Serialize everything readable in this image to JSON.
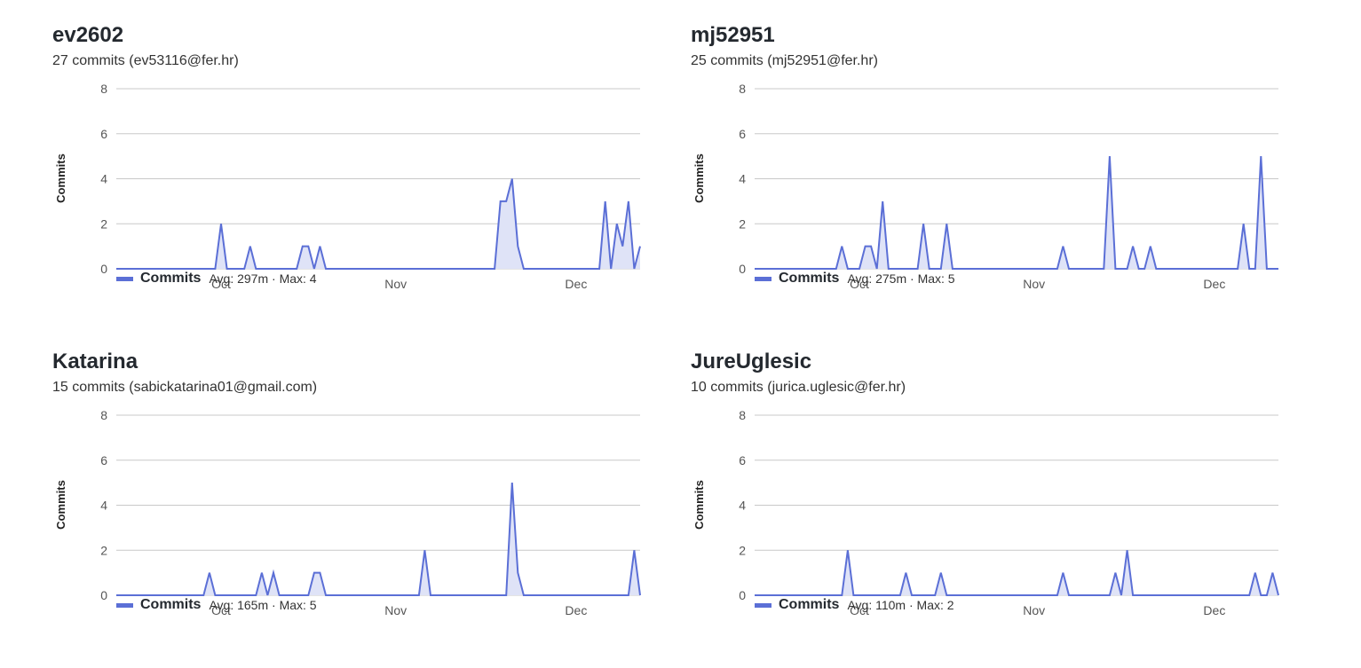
{
  "style": {
    "line_color": "#5b6fd6",
    "fill_color": "#dfe3f7",
    "grid_color": "#c8c8c8"
  },
  "panels": [
    {
      "name": "ev2602",
      "subtitle": "27 commits (ev53116@fer.hr)",
      "legend": {
        "label": "Commits",
        "stats": "Avg: 297m · Max: 4"
      }
    },
    {
      "name": "mj52951",
      "subtitle": "25 commits (mj52951@fer.hr)",
      "legend": {
        "label": "Commits",
        "stats": "Avg: 275m · Max: 5"
      }
    },
    {
      "name": "Katarina",
      "subtitle": "15 commits (sabickatarina01@gmail.com)",
      "legend": {
        "label": "Commits",
        "stats": "Avg: 165m · Max: 5"
      }
    },
    {
      "name": "JureUglesic",
      "subtitle": "10 commits (jurica.uglesic@fer.hr)",
      "legend": {
        "label": "Commits",
        "stats": "Avg: 110m · Max: 2"
      }
    }
  ],
  "chart_data": [
    {
      "type": "area",
      "ylabel": "Commits",
      "ylim": [
        0,
        8
      ],
      "yticks": [
        0,
        2,
        4,
        6,
        8
      ],
      "xlim": [
        0,
        90
      ],
      "xticks": [
        {
          "x": 18,
          "label": "Oct"
        },
        {
          "x": 48,
          "label": "Nov"
        },
        {
          "x": 79,
          "label": "Dec"
        }
      ],
      "grid": true,
      "legend_position": "bottom-left",
      "series": [
        {
          "name": "Commits",
          "points": [
            [
              0,
              0
            ],
            [
              17,
              0
            ],
            [
              18,
              2
            ],
            [
              19,
              0
            ],
            [
              22,
              0
            ],
            [
              23,
              1
            ],
            [
              24,
              0
            ],
            [
              31,
              0
            ],
            [
              32,
              1
            ],
            [
              33,
              1
            ],
            [
              34,
              0
            ],
            [
              35,
              1
            ],
            [
              36,
              0
            ],
            [
              65,
              0
            ],
            [
              66,
              3
            ],
            [
              67,
              3
            ],
            [
              68,
              4
            ],
            [
              69,
              1
            ],
            [
              70,
              0
            ],
            [
              83,
              0
            ],
            [
              84,
              3
            ],
            [
              85,
              0
            ],
            [
              86,
              2
            ],
            [
              87,
              1
            ],
            [
              88,
              3
            ],
            [
              89,
              0
            ],
            [
              90,
              1
            ]
          ]
        }
      ]
    },
    {
      "type": "area",
      "ylabel": "Commits",
      "ylim": [
        0,
        8
      ],
      "yticks": [
        0,
        2,
        4,
        6,
        8
      ],
      "xlim": [
        0,
        90
      ],
      "xticks": [
        {
          "x": 18,
          "label": "Oct"
        },
        {
          "x": 48,
          "label": "Nov"
        },
        {
          "x": 79,
          "label": "Dec"
        }
      ],
      "grid": true,
      "legend_position": "bottom-left",
      "series": [
        {
          "name": "Commits",
          "points": [
            [
              0,
              0
            ],
            [
              14,
              0
            ],
            [
              15,
              1
            ],
            [
              16,
              0
            ],
            [
              18,
              0
            ],
            [
              19,
              1
            ],
            [
              20,
              1
            ],
            [
              21,
              0
            ],
            [
              22,
              3
            ],
            [
              23,
              0
            ],
            [
              28,
              0
            ],
            [
              29,
              2
            ],
            [
              30,
              0
            ],
            [
              32,
              0
            ],
            [
              33,
              2
            ],
            [
              34,
              0
            ],
            [
              52,
              0
            ],
            [
              53,
              1
            ],
            [
              54,
              0
            ],
            [
              60,
              0
            ],
            [
              61,
              5
            ],
            [
              62,
              0
            ],
            [
              64,
              0
            ],
            [
              65,
              1
            ],
            [
              66,
              0
            ],
            [
              67,
              0
            ],
            [
              68,
              1
            ],
            [
              69,
              0
            ],
            [
              83,
              0
            ],
            [
              84,
              2
            ],
            [
              85,
              0
            ],
            [
              86,
              0
            ],
            [
              87,
              5
            ],
            [
              88,
              0
            ],
            [
              90,
              0
            ]
          ]
        }
      ]
    },
    {
      "type": "area",
      "ylabel": "Commits",
      "ylim": [
        0,
        8
      ],
      "yticks": [
        0,
        2,
        4,
        6,
        8
      ],
      "xlim": [
        0,
        90
      ],
      "xticks": [
        {
          "x": 18,
          "label": "Oct"
        },
        {
          "x": 48,
          "label": "Nov"
        },
        {
          "x": 79,
          "label": "Dec"
        }
      ],
      "grid": true,
      "legend_position": "bottom-left",
      "series": [
        {
          "name": "Commits",
          "points": [
            [
              0,
              0
            ],
            [
              15,
              0
            ],
            [
              16,
              1
            ],
            [
              17,
              0
            ],
            [
              24,
              0
            ],
            [
              25,
              1
            ],
            [
              26,
              0
            ],
            [
              27,
              1
            ],
            [
              28,
              0
            ],
            [
              33,
              0
            ],
            [
              34,
              1
            ],
            [
              35,
              1
            ],
            [
              36,
              0
            ],
            [
              52,
              0
            ],
            [
              53,
              2
            ],
            [
              54,
              0
            ],
            [
              67,
              0
            ],
            [
              68,
              5
            ],
            [
              69,
              1
            ],
            [
              70,
              0
            ],
            [
              88,
              0
            ],
            [
              89,
              2
            ],
            [
              90,
              0
            ]
          ]
        }
      ]
    },
    {
      "type": "area",
      "ylabel": "Commits",
      "ylim": [
        0,
        8
      ],
      "yticks": [
        0,
        2,
        4,
        6,
        8
      ],
      "xlim": [
        0,
        90
      ],
      "xticks": [
        {
          "x": 18,
          "label": "Oct"
        },
        {
          "x": 48,
          "label": "Nov"
        },
        {
          "x": 79,
          "label": "Dec"
        }
      ],
      "grid": true,
      "legend_position": "bottom-left",
      "series": [
        {
          "name": "Commits",
          "points": [
            [
              0,
              0
            ],
            [
              15,
              0
            ],
            [
              16,
              2
            ],
            [
              17,
              0
            ],
            [
              25,
              0
            ],
            [
              26,
              1
            ],
            [
              27,
              0
            ],
            [
              31,
              0
            ],
            [
              32,
              1
            ],
            [
              33,
              0
            ],
            [
              52,
              0
            ],
            [
              53,
              1
            ],
            [
              54,
              0
            ],
            [
              61,
              0
            ],
            [
              62,
              1
            ],
            [
              63,
              0
            ],
            [
              64,
              2
            ],
            [
              65,
              0
            ],
            [
              85,
              0
            ],
            [
              86,
              1
            ],
            [
              87,
              0
            ],
            [
              88,
              0
            ],
            [
              89,
              1
            ],
            [
              90,
              0
            ]
          ]
        }
      ]
    }
  ]
}
